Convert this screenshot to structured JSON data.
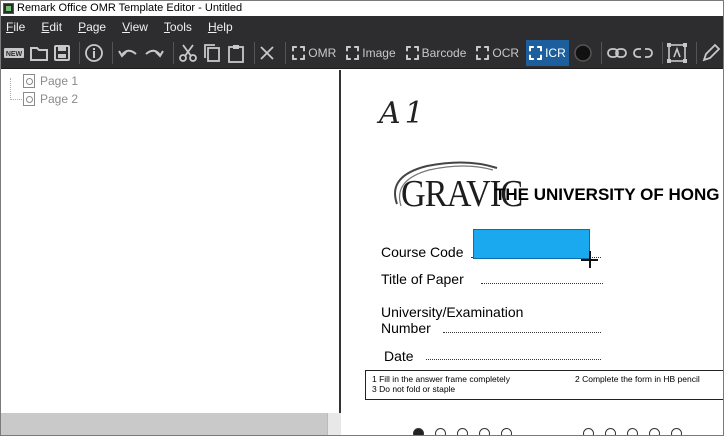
{
  "window": {
    "title": "Remark Office OMR Template Editor - Untitled"
  },
  "menu": [
    "File",
    "Edit",
    "Page",
    "View",
    "Tools",
    "Help"
  ],
  "toolbar": {
    "file_icons": [
      "new-icon",
      "open-folder-icon",
      "save-icon",
      "info-icon"
    ],
    "edit_icons": [
      "undo-icon",
      "redo-icon",
      "cut-icon",
      "copy-icon",
      "paste-icon",
      "delete-icon"
    ],
    "tools": [
      {
        "label": "OMR",
        "active": false
      },
      {
        "label": "Image",
        "active": false
      },
      {
        "label": "Barcode",
        "active": false
      },
      {
        "label": "OCR",
        "active": false
      },
      {
        "label": "ICR",
        "active": true
      }
    ],
    "extra_icons": [
      "record-icon",
      "link-icon",
      "unlink-icon",
      "text-region-icon",
      "pen-icon"
    ]
  },
  "pages": [
    {
      "label": "Page 1"
    },
    {
      "label": "Page 2"
    }
  ],
  "document": {
    "handwritten": "A1",
    "logo": "GRAVIC",
    "university": "THE UNIVERSITY OF HONG K",
    "fields": {
      "course_code": "Course Code",
      "title_of_paper": "Title of Paper",
      "university_exam_line1": "University/Examination",
      "university_exam_line2": "Number",
      "date": "Date"
    },
    "instructions": {
      "item1": "1 Fill in the answer frame completely",
      "item2": "2 Complete the form in HB pencil",
      "item3": "3 Do not fold or staple"
    },
    "icr_region_color": "#1aa9ef"
  },
  "colors": {
    "toolbar_bg": "#2d2d30",
    "active_tool": "#1c5f9c"
  }
}
